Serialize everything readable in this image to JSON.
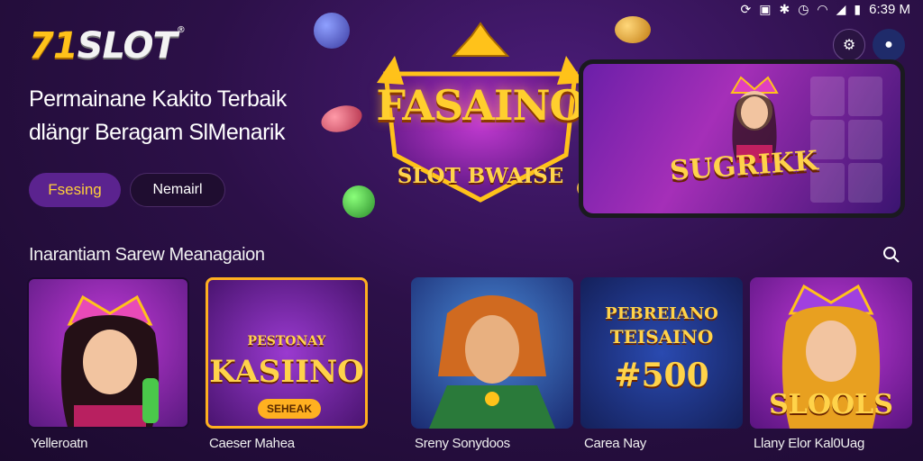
{
  "status_bar": {
    "time": "6:39 M"
  },
  "logo": {
    "number": "71",
    "text": "SLOT",
    "registered": "®"
  },
  "hero": {
    "headline_line1": "Permainane Kakito Terbaik",
    "headline_line2": "dlängr Beragam SlMenarik",
    "primary_button": "Fsesing",
    "secondary_button": "Nemairl",
    "emblem_title": "FASAINO",
    "emblem_subtitle": "SLOT BWAISE",
    "phone_banner": "SUGRIKK"
  },
  "section": {
    "title": "Inarantiam Sarew Meanagaion"
  },
  "games": [
    {
      "name": "Yelleroatn",
      "thumb_text": "",
      "icon": "queen-character"
    },
    {
      "name": "Caeser Mahea",
      "thumb_text_top": "PESTONAY",
      "thumb_text_main": "KASIINO",
      "thumb_badge": "SEHEAK",
      "icon": "casino-emblem"
    },
    {
      "name": "Sreny Sonydoos",
      "thumb_text": "",
      "icon": "warrior-character"
    },
    {
      "name": "Carea Nay",
      "thumb_text_top": "PEBREIANO",
      "thumb_text_main": "TEISAINO",
      "thumb_amount": "#500",
      "icon": "jackpot-emblem"
    },
    {
      "name": "Llany Elor Kal0Uag",
      "thumb_text_main": "SLOOLS",
      "icon": "queen-character"
    }
  ],
  "icons": {
    "search": "search-icon",
    "settings": "gear-icon",
    "profile": "user-icon"
  },
  "colors": {
    "background": "#2c1048",
    "accent_gold": "#ffc21a",
    "primary_button_bg": "#5b238f",
    "primary_button_text": "#ffcf3a"
  }
}
